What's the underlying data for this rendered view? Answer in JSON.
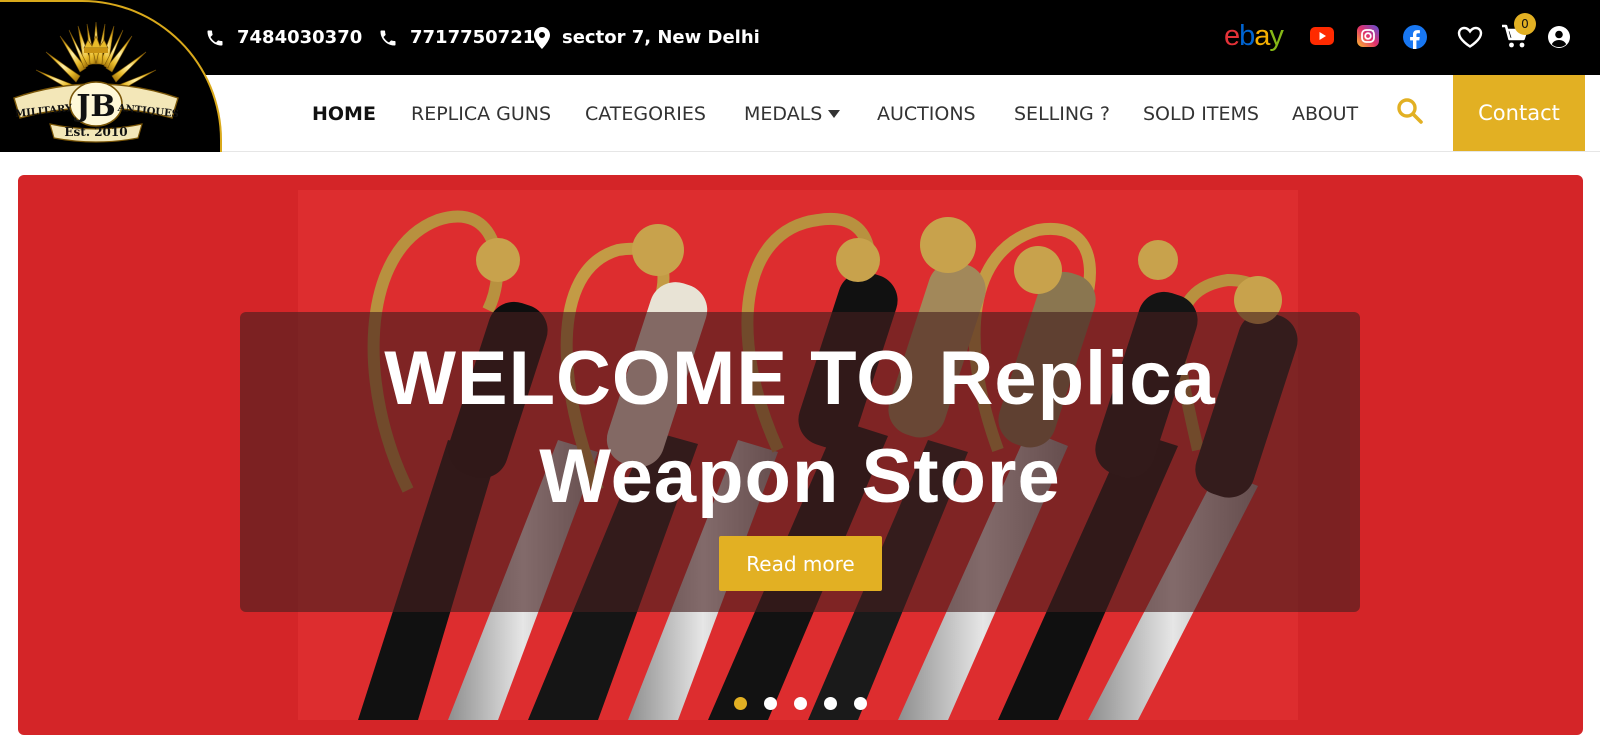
{
  "logo": {
    "initials": "JB",
    "left_word": "MILITARY",
    "right_word": "ANTIQUES",
    "est": "Est. 2010"
  },
  "topbar": {
    "phone1": "7484030370",
    "phone2": "7717750721",
    "location": "sector 7, New Delhi",
    "cart_count": "0"
  },
  "social": {
    "ebay": {
      "e": "e",
      "b": "b",
      "a": "a",
      "y": "y"
    }
  },
  "nav": {
    "items": [
      "HOME",
      "REPLICA GUNS",
      "CATEGORIES",
      "MEDALS",
      "AUCTIONS",
      "SELLING ?",
      "SOLD ITEMS",
      "ABOUT"
    ],
    "contact_label": "Contact"
  },
  "hero": {
    "title_line1": "WELCOME TO Replica",
    "title_line2": "Weapon Store",
    "button_label": "Read more",
    "slides_total": 5,
    "active_slide": 1
  },
  "colors": {
    "accent": "#e2b023",
    "hero_bg": "#d42528",
    "topbar": "#000000"
  }
}
